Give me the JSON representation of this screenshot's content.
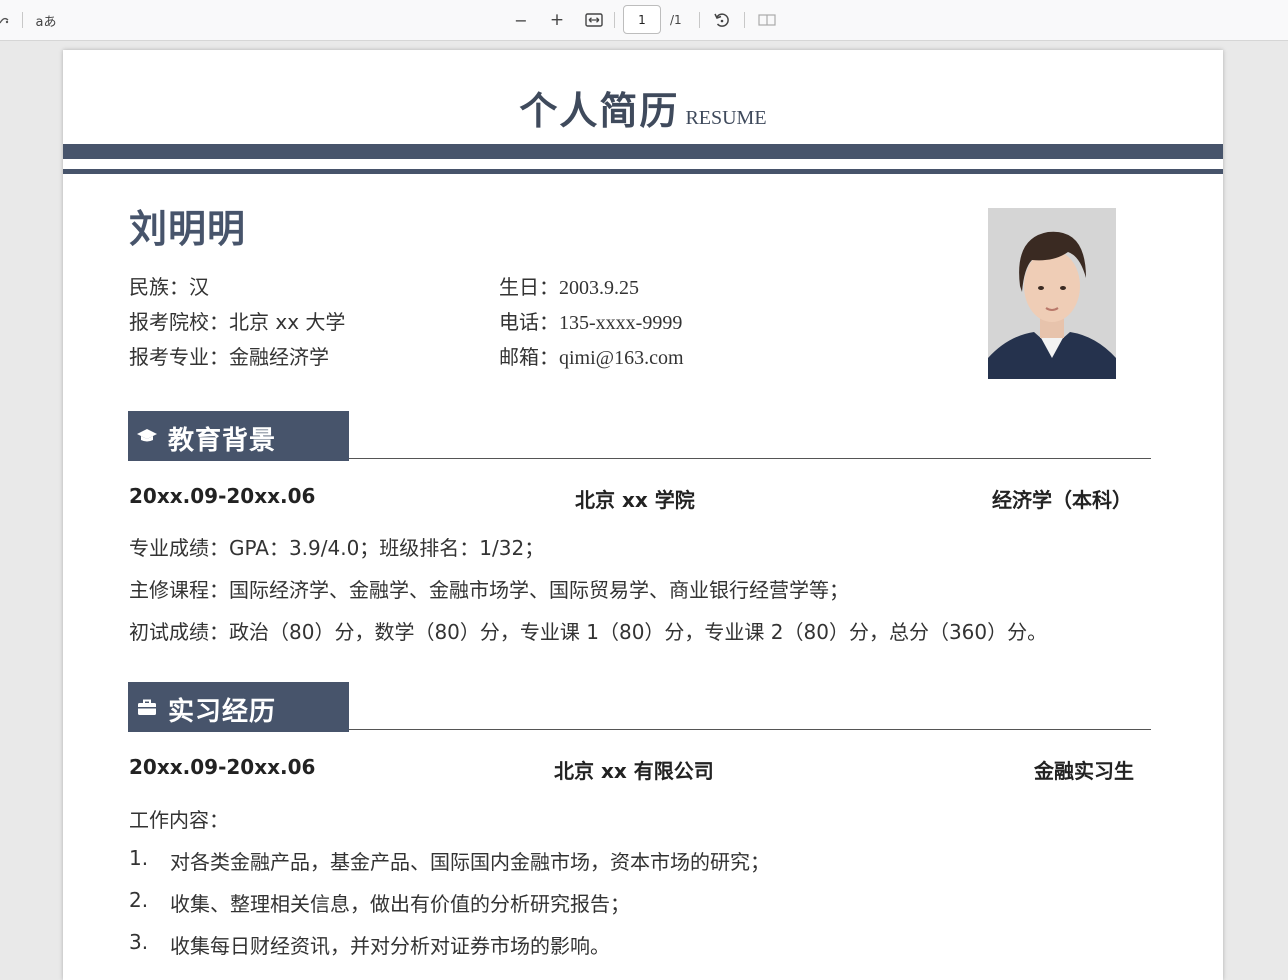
{
  "viewer": {
    "left_icon": "read-aloud-icon",
    "text_size_label": "aあ",
    "zoom_out": "−",
    "zoom_in": "+",
    "page_number": "1",
    "page_total": "/1"
  },
  "resume": {
    "title": "个人简历",
    "title_en": "RESUME",
    "name": "刘明明",
    "fields": {
      "ethnicity_label": "民族：",
      "ethnicity_value": "汉",
      "birthday_label": "生日：",
      "birthday_value": "2003.9.25",
      "school_label": "报考院校：",
      "school_value": "北京 xx 大学",
      "phone_label": "电话：",
      "phone_value": "135-xxxx-9999",
      "major_label": "报考专业：",
      "major_value": "金融经济学",
      "email_label": "邮箱：",
      "email_value": "qimi@163.com"
    },
    "education": {
      "heading": "教育背景",
      "period": "20xx.09-20xx.06",
      "school": "北京 xx 学院",
      "degree": "经济学（本科）",
      "lines": [
        "专业成绩：GPA：3.9/4.0；班级排名：1/32；",
        "主修课程：国际经济学、金融学、金融市场学、国际贸易学、商业银行经营学等；",
        "初试成绩：政治（80）分，数学（80）分，专业课 1（80）分，专业课 2（80）分，总分（360）分。"
      ]
    },
    "internship": {
      "heading": "实习经历",
      "period": "20xx.09-20xx.06",
      "company": "北京 xx 有限公司",
      "role": "金融实习生",
      "content_label": "工作内容：",
      "items": [
        {
          "num": "1.",
          "text": "对各类金融产品，基金产品、国际国内金融市场，资本市场的研究；"
        },
        {
          "num": "2.",
          "text": "收集、整理相关信息，做出有价值的分析研究报告；"
        },
        {
          "num": "3.",
          "text": "收集每日财经资讯，并对分析对证券市场的影响。"
        }
      ]
    },
    "colors": {
      "accent": "#47546b",
      "text": "#333333"
    }
  }
}
